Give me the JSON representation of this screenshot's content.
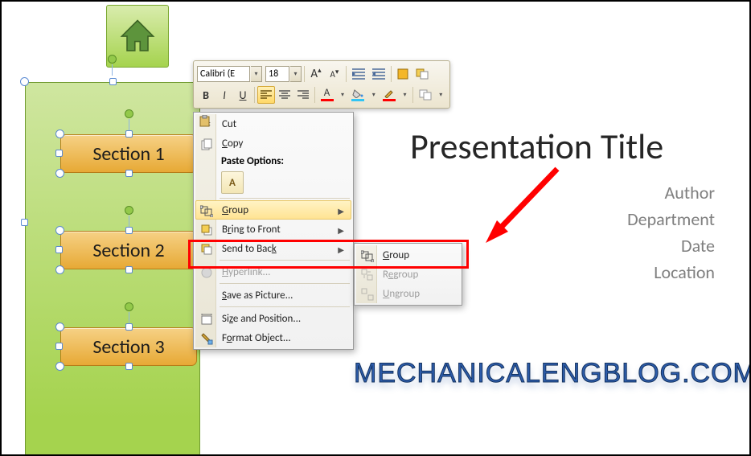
{
  "home_icon": "home-icon",
  "sections": [
    "Section 1",
    "Section 2",
    "Section 3"
  ],
  "mini_toolbar": {
    "font_name": "Calibri (E",
    "font_size": "18",
    "grow": "A",
    "shrink": "A",
    "bold": "B",
    "italic": "I",
    "underline": "U"
  },
  "context_menu": {
    "cut": "Cut",
    "copy": "Copy",
    "paste_label": "Paste Options:",
    "paste_option_a": "A",
    "group": "Group",
    "bring_front": "Bring to Front",
    "send_back": "Send to Back",
    "hyperlink": "Hyperlink...",
    "save_pic": "Save as Picture...",
    "size_pos": "Size and Position...",
    "format_obj": "Format Object..."
  },
  "group_submenu": {
    "group": "Group",
    "regroup": "Regroup",
    "ungroup": "Ungroup"
  },
  "slide": {
    "title": "Presentation Title",
    "author": "Author",
    "department": "Department",
    "date": "Date",
    "location": "Location"
  },
  "watermark": "MECHANICALENGBLOG.COM"
}
